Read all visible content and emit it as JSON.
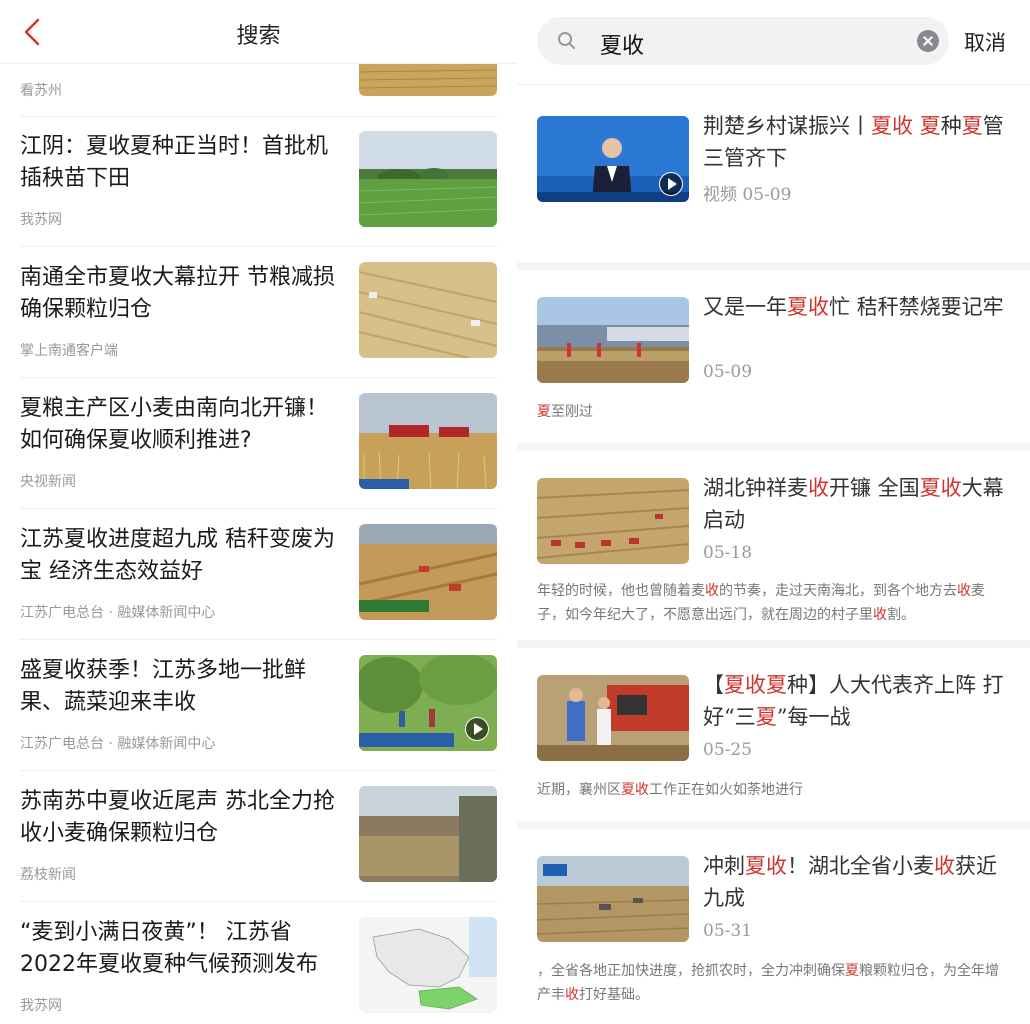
{
  "left": {
    "header_title": "搜索",
    "partial_source": "看苏州",
    "items": [
      {
        "title": "江阴：夏收夏种正当时！首批机插秧苗下田",
        "source": "我苏网"
      },
      {
        "title": "南通全市夏收大幕拉开 节粮减损确保颗粒归仓",
        "source": "掌上南通客户端"
      },
      {
        "title": "夏粮主产区小麦由南向北开镰！如何确保夏收顺利推进?",
        "source": "央视新闻"
      },
      {
        "title": "江苏夏收进度超九成 秸秆变废为宝 经济生态效益好",
        "source": "江苏广电总台 · 融媒体新闻中心"
      },
      {
        "title": "盛夏收获季！江苏多地一批鲜果、蔬菜迎来丰收",
        "source": "江苏广电总台 · 融媒体新闻中心"
      },
      {
        "title": "苏南苏中夏收近尾声 苏北全力抢收小麦确保颗粒归仓",
        "source": "荔枝新闻"
      },
      {
        "title": "“麦到小满日夜黄”！ 江苏省2022年夏收夏种气候预测发布",
        "source": "我苏网"
      }
    ]
  },
  "right": {
    "search_query": "夏收",
    "cancel_label": "取消",
    "highlight_color": "#d0342c",
    "results": [
      {
        "title_parts": [
          {
            "t": "荆楚乡村谋振兴丨",
            "h": false
          },
          {
            "t": "夏收",
            "h": true
          },
          {
            "t": "  ",
            "h": false
          },
          {
            "t": "夏",
            "h": true
          },
          {
            "t": "种",
            "h": false
          },
          {
            "t": "夏",
            "h": true
          },
          {
            "t": "管  三管齐下",
            "h": false
          }
        ],
        "meta": "视频  05-09",
        "snippet_parts": []
      },
      {
        "title_parts": [
          {
            "t": "又是一年",
            "h": false
          },
          {
            "t": "夏收",
            "h": true
          },
          {
            "t": "忙  秸秆禁烧要记牢",
            "h": false
          }
        ],
        "meta": "05-09",
        "snippet_parts": [
          {
            "t": "夏",
            "h": true
          },
          {
            "t": "至刚过",
            "h": false
          }
        ]
      },
      {
        "title_parts": [
          {
            "t": "湖北钟祥麦",
            "h": false
          },
          {
            "t": "收",
            "h": true
          },
          {
            "t": "开镰  全国",
            "h": false
          },
          {
            "t": "夏收",
            "h": true
          },
          {
            "t": "大幕启动",
            "h": false
          }
        ],
        "meta": "05-18",
        "snippet_parts": [
          {
            "t": "年轻的时候，他也曾随着麦",
            "h": false
          },
          {
            "t": "收",
            "h": true
          },
          {
            "t": "的节奏，走过天南海北，到各个地方去",
            "h": false
          },
          {
            "t": "收",
            "h": true
          },
          {
            "t": "麦子，如今年纪大了，不愿意出远门，就在周边的村子里",
            "h": false
          },
          {
            "t": "收",
            "h": true
          },
          {
            "t": "割。",
            "h": false
          }
        ]
      },
      {
        "title_parts": [
          {
            "t": "【",
            "h": false
          },
          {
            "t": "夏收夏",
            "h": true
          },
          {
            "t": "种】人大代表齐上阵  打好“三",
            "h": false
          },
          {
            "t": "夏",
            "h": true
          },
          {
            "t": "”每一战",
            "h": false
          }
        ],
        "meta": "05-25",
        "snippet_parts": [
          {
            "t": "近期，襄州区",
            "h": false
          },
          {
            "t": "夏收",
            "h": true
          },
          {
            "t": "工作正在如火如荼地进行",
            "h": false
          }
        ]
      },
      {
        "title_parts": [
          {
            "t": "冲刺",
            "h": false
          },
          {
            "t": "夏收",
            "h": true
          },
          {
            "t": "！湖北全省小麦",
            "h": false
          },
          {
            "t": "收",
            "h": true
          },
          {
            "t": "获近九成",
            "h": false
          }
        ],
        "meta": "05-31",
        "snippet_parts": [
          {
            "t": "，全省各地正加快进度，抢抓农时，全力冲刺确保",
            "h": false
          },
          {
            "t": "夏",
            "h": true
          },
          {
            "t": "粮颗粒归仓，为全年增产丰",
            "h": false
          },
          {
            "t": "收",
            "h": true
          },
          {
            "t": "打好基础。",
            "h": false
          }
        ]
      }
    ]
  }
}
